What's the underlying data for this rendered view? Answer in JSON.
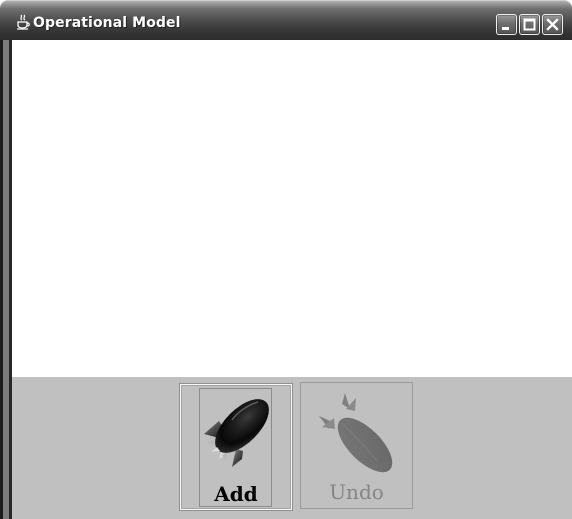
{
  "window": {
    "title": "Operational Model"
  },
  "icons": {
    "app": "java-coffee-cup-icon",
    "minimize": "minimize-icon",
    "maximize": "maximize-icon",
    "close": "close-icon",
    "add": "rocket-icon",
    "undo": "rocket-disabled-icon"
  },
  "toolbar": {
    "add_label": "Add",
    "undo_label": "Undo",
    "undo_enabled": false
  },
  "colors": {
    "toolbar_background": "#c0c0c0",
    "disabled_text": "#858585",
    "content_background": "#ffffff"
  }
}
